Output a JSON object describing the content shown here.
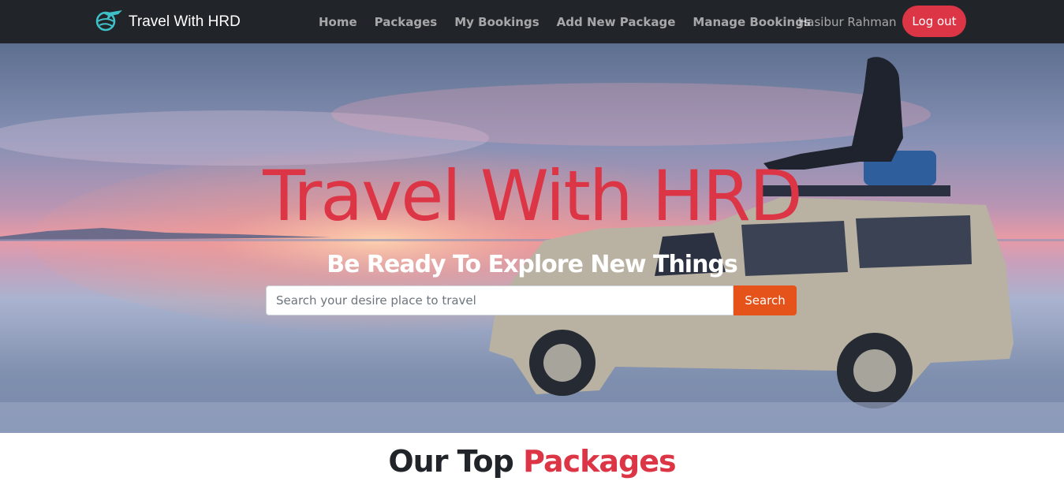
{
  "brand": {
    "name": "Travel With HRD",
    "icon": "globe-plane-icon"
  },
  "nav": {
    "items": [
      {
        "label": "Home"
      },
      {
        "label": "Packages"
      },
      {
        "label": "My Bookings"
      },
      {
        "label": "Add New Package"
      },
      {
        "label": "Manage Bookings"
      }
    ],
    "user_name": "Hasibur Rahman",
    "logout_label": "Log out"
  },
  "hero": {
    "title": "Travel With HRD",
    "subtitle": "Be Ready To Explore New Things",
    "search": {
      "placeholder": "Search your desire place to travel",
      "value": "",
      "button_label": "Search"
    }
  },
  "section": {
    "title_part1": "Our Top",
    "title_part2": "Packages"
  },
  "colors": {
    "accent": "#dc3545",
    "navbar": "#212529",
    "search_button": "#e5531a"
  }
}
